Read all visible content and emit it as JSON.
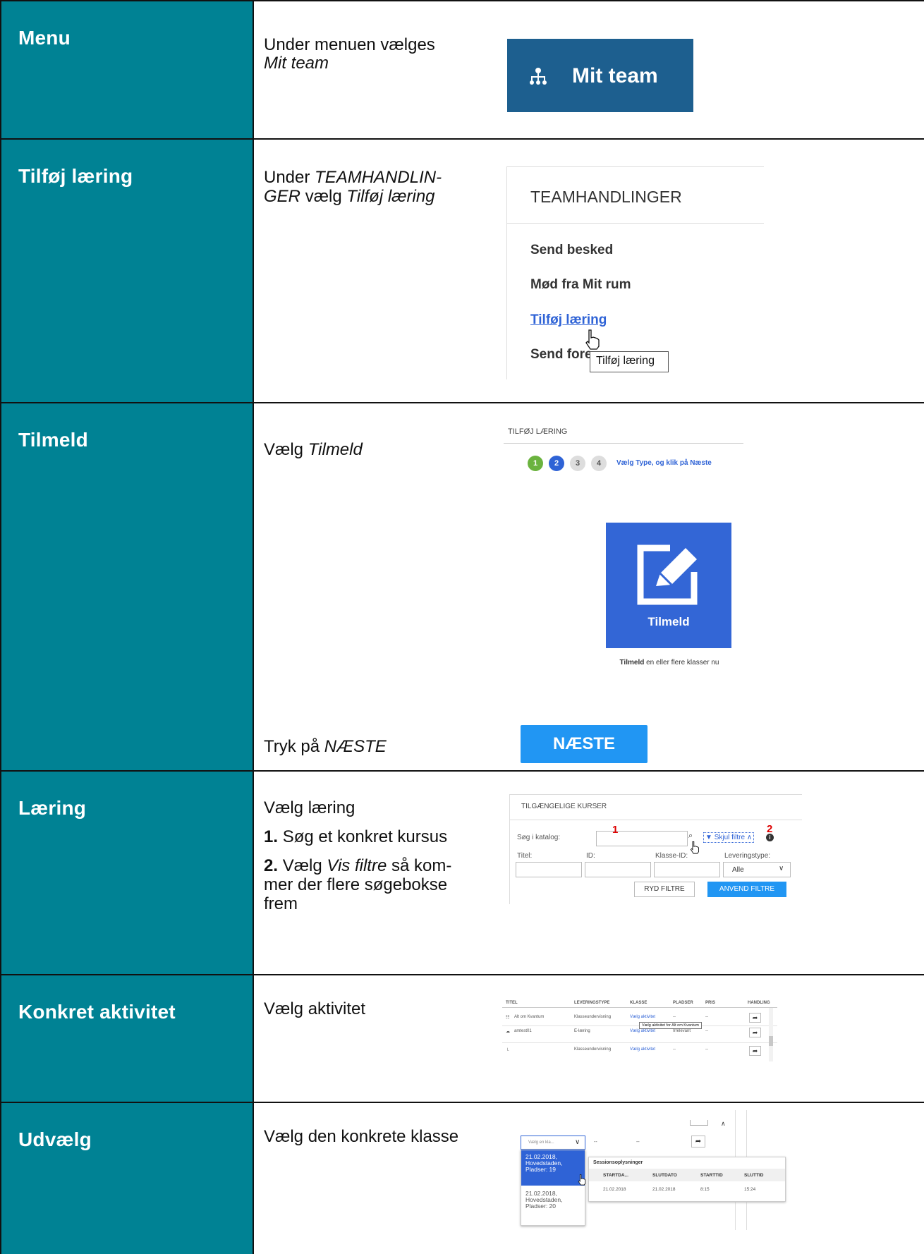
{
  "rows": [
    {
      "label": "Menu",
      "t1": "Under menuen vælges",
      "t2": "Mit team"
    },
    {
      "label": "Tilføj læring",
      "t1": "Under",
      "t1i": "TEAMHANDLIN-",
      "t2i": "GER",
      "t2": "vælg",
      "t2b": "Tilføj læring"
    },
    {
      "label": "Tilmeld",
      "t1": "Vælg",
      "t1i": "Tilmeld",
      "t2": "Tryk på",
      "t2i": "NÆSTE"
    },
    {
      "label": "Læring",
      "t1": "Vælg læring",
      "n1": "1.",
      "t2": "Søg et konkret kursus",
      "n2": "2.",
      "t3": "Vælg",
      "t3i": "Vis filtre",
      "t3b": "så kom-",
      "t4": "mer der flere søgebokse",
      "t5": "frem"
    },
    {
      "label": "Konkret aktivitet",
      "t1": "Vælg aktivitet"
    },
    {
      "label": "Udvælg",
      "t1": "Vælg den konkrete klasse"
    }
  ],
  "shot_menu": {
    "label": "Mit team",
    "icon": "org-chart-icon"
  },
  "shot_team": {
    "header": "TEAMHANDLINGER",
    "items": [
      "Send besked",
      "Mød fra Mit rum",
      "Tilføj læring",
      "Send fore"
    ],
    "tooltip": "Tilføj læring"
  },
  "shot_tilmeld": {
    "header": "TILFØJ LÆRING",
    "steps": [
      "1",
      "2",
      "3",
      "4"
    ],
    "step_hint": "Vælg Type, og klik på Næste",
    "tile_label": "Tilmeld",
    "caption_bold": "Tilmeld",
    "caption_rest": "en eller flere klasser nu",
    "next_button": "NÆSTE"
  },
  "shot_kurser": {
    "header": "TILGÆNGELIGE KURSER",
    "search_label": "Søg i katalog:",
    "marker1": "1",
    "marker2": "2",
    "hide_filters": "Skjul filtre",
    "col_titel": "Titel:",
    "col_id": "ID:",
    "col_klasse": "Klasse-ID:",
    "col_lev": "Leveringstype:",
    "lev_value": "Alle",
    "clear_button": "RYD FILTRE",
    "apply_button": "ANVEND FILTRE"
  },
  "shot_aktivitet": {
    "headers": [
      "TITEL",
      "LEVERINGSTYPE",
      "KLASSE",
      "PLADSER",
      "PRIS",
      "HANDLING"
    ],
    "rows": [
      [
        "Alt om Kvantum",
        "Klasseundervisning",
        "Vælg aktivitet",
        "--",
        "--"
      ],
      [
        "amtest01",
        "E-læring",
        "Vælg aktivitet",
        "Irrelevant",
        "--"
      ],
      [
        "",
        "Klasseundervisning",
        "Vælg aktivitet",
        "--",
        "--"
      ]
    ],
    "tooltip": "Vælg aktivitet for Alt om Kvantum"
  },
  "shot_udvaelg": {
    "select_placeholder": "Vælg en kla...",
    "options": [
      [
        "21.02.2018,",
        "Hovedstaden,",
        "Pladser: 19"
      ],
      [
        "21.02.2018,",
        "Hovedstaden,",
        "Pladser: 20"
      ]
    ],
    "session_title": "Sessionsoplysninger",
    "session_headers": [
      "STARTDA...",
      "SLUTDATO",
      "STARTTID",
      "SLUTTID"
    ],
    "session_row": [
      "21.02.2018",
      "21.02.2018",
      "8:15",
      "15:24"
    ],
    "dash": "--"
  },
  "colors": {
    "teal": "#008294",
    "navy": "#1d5f8f",
    "blue": "#2f63d6",
    "sky": "#2196f3",
    "green": "#6bb33f"
  }
}
